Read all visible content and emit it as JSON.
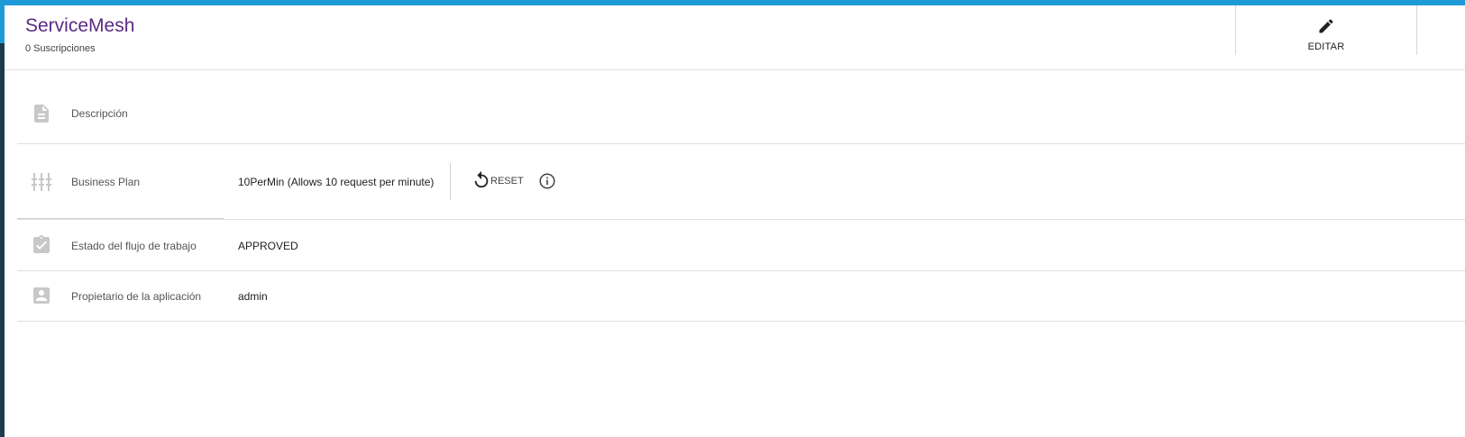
{
  "header": {
    "app_name": "ServiceMesh",
    "subscriptions_count": "0",
    "subscriptions_label": "Suscripciones",
    "edit_label": "EDITAR"
  },
  "rows": {
    "description": {
      "icon": "document-icon",
      "label": "Descripción"
    },
    "business_plan": {
      "icon": "tune-icon",
      "label": "Business Plan",
      "value": "10PerMin (Allows 10 request per minute)",
      "reset_label": "RESET",
      "info_icon": "info-icon"
    },
    "workflow": {
      "icon": "clipboard-check-icon",
      "label": "Estado del flujo de trabajo",
      "value": "APPROVED"
    },
    "owner": {
      "icon": "account-box-icon",
      "label": "Propietario de la aplicación",
      "value": "admin"
    }
  },
  "colors": {
    "accent": "#1e9ad6",
    "title": "#5a2a82",
    "sidebar": "#1c3b4c"
  }
}
